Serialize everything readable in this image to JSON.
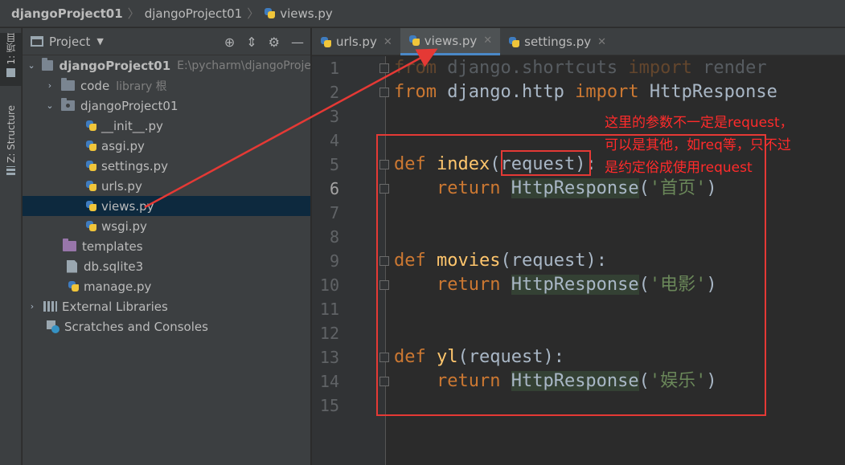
{
  "breadcrumb": {
    "project": "djangoProject01",
    "folder": "djangoProject01",
    "file": "views.py"
  },
  "toolstrip": {
    "tab1": "1: 项目",
    "tab2": "Z: Structure"
  },
  "project_panel": {
    "title": "Project",
    "tree": [
      {
        "label": "djangoProject01",
        "hint": "E:\\pycharm\\djangoProje",
        "kind": "root"
      },
      {
        "label": "code",
        "hint": "library 根",
        "kind": "folder"
      },
      {
        "label": "djangoProject01",
        "kind": "folder"
      },
      {
        "label": "__init__.py",
        "kind": "py"
      },
      {
        "label": "asgi.py",
        "kind": "py"
      },
      {
        "label": "settings.py",
        "kind": "py"
      },
      {
        "label": "urls.py",
        "kind": "py"
      },
      {
        "label": "views.py",
        "kind": "py"
      },
      {
        "label": "wsgi.py",
        "kind": "py"
      },
      {
        "label": "templates",
        "kind": "folder"
      },
      {
        "label": "db.sqlite3",
        "kind": "file"
      },
      {
        "label": "manage.py",
        "kind": "py"
      },
      {
        "label": "External Libraries",
        "kind": "lib"
      },
      {
        "label": "Scratches and Consoles",
        "kind": "scratch"
      }
    ]
  },
  "tabs": [
    {
      "label": "urls.py"
    },
    {
      "label": "views.py",
      "active": true
    },
    {
      "label": "settings.py"
    }
  ],
  "editor": {
    "line_numbers": [
      "1",
      "2",
      "3",
      "4",
      "5",
      "6",
      "7",
      "8",
      "9",
      "10",
      "11",
      "12",
      "13",
      "14",
      "15"
    ],
    "tokens": {
      "from": "from",
      "import": "import",
      "def": "def",
      "return": "return",
      "mod1": " django.shortcuts ",
      "name1": " render",
      "mod2": " django.http ",
      "name2": " HttpResponse",
      "index": "index",
      "movies": "movies",
      "yl": "yl",
      "request": "request",
      "open_paren": "(",
      "close_colon": "):",
      "http_response": "HttpResponse",
      "s1": "'首页'",
      "s2": "'电影'",
      "s3": "'娱乐'",
      "rparen": ")"
    }
  },
  "annotation": {
    "line1": "这里的参数不一定是request，",
    "line2": "可以是其他，如req等，只不过",
    "line3": "是约定俗成使用request"
  },
  "colors": {
    "annotation": "#e53935",
    "keyword": "#cc7832",
    "function": "#ffc66d",
    "string": "#6a8759"
  }
}
